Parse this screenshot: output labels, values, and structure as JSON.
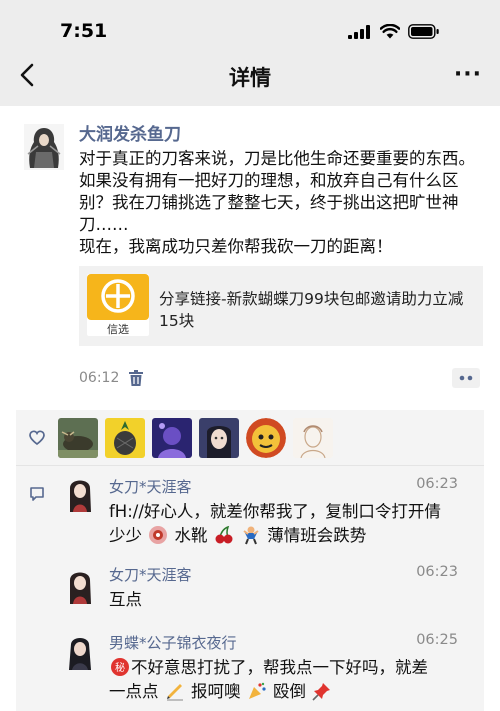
{
  "status_bar": {
    "time": "7:51"
  },
  "nav": {
    "title": "详情",
    "more": "···"
  },
  "post": {
    "author": "大润发杀鱼刀",
    "lines": [
      "对于真正的刀客来说，刀是比他生命还要重要的东西。",
      "如果没有拥有一把好刀的理想，和放弃自己有什么区",
      "别？我在刀铺挑选了整整七天，终于挑出这把旷世神",
      "刀……",
      "现在，我离成功只差你帮我砍一刀的距离！"
    ],
    "share": {
      "icon_label": "信选",
      "text": "分享链接-新款蝴蝶刀99块包邮邀请助力立减15块"
    },
    "time": "06:12"
  },
  "likes": {
    "avatars": [
      "bull-avatar",
      "pineapple-avatar",
      "purple-avatar",
      "anime-avatar",
      "cartoon-face-avatar",
      "sketch-avatar"
    ]
  },
  "comments": [
    {
      "name": "女刀*天涯客",
      "time": "06:23",
      "line1": "fH://好心人，就差你帮我了，复制口令打开倩",
      "line2_a": "少少",
      "line2_b": "水靴",
      "line2_c": "薄情班会跌势"
    },
    {
      "name": "女刀*天涯客",
      "time": "06:23",
      "line1": "互点"
    },
    {
      "name": "男蝶*公子锦衣夜行",
      "time": "06:25",
      "line1": "不好意思打扰了，帮我点一下好吗，就差",
      "line2_a": "一点点",
      "line2_b": "报呵噢",
      "line2_c": "殴倒"
    }
  ],
  "colors": {
    "accent": "#56688f",
    "topbar": "#ededed",
    "panel": "#f4f4f4"
  }
}
